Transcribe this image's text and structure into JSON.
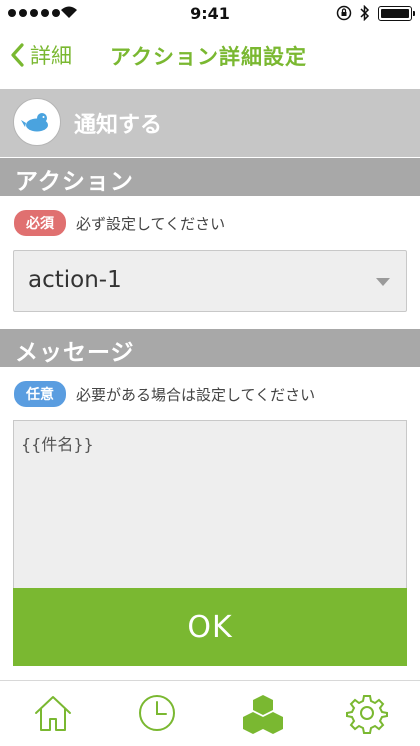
{
  "status_bar": {
    "time": "9:41"
  },
  "nav": {
    "back_label": "詳細",
    "title": "アクション詳細設定"
  },
  "notify": {
    "label": "通知する"
  },
  "action_section": {
    "title": "アクション",
    "badge": "必須",
    "hint": "必ず設定してください",
    "select_value": "action-1"
  },
  "message_section": {
    "title": "メッセージ",
    "badge": "任意",
    "hint": "必要がある場合は設定してください",
    "textarea_value": "{{件名}}"
  },
  "ok_label": "OK",
  "colors": {
    "accent": "#7ab831",
    "required": "#e07070",
    "optional": "#5a9de0",
    "section": "#a8a8a8"
  },
  "tabs": [
    {
      "icon": "home-icon"
    },
    {
      "icon": "clock-icon"
    },
    {
      "icon": "cubes-icon"
    },
    {
      "icon": "gear-icon"
    }
  ]
}
